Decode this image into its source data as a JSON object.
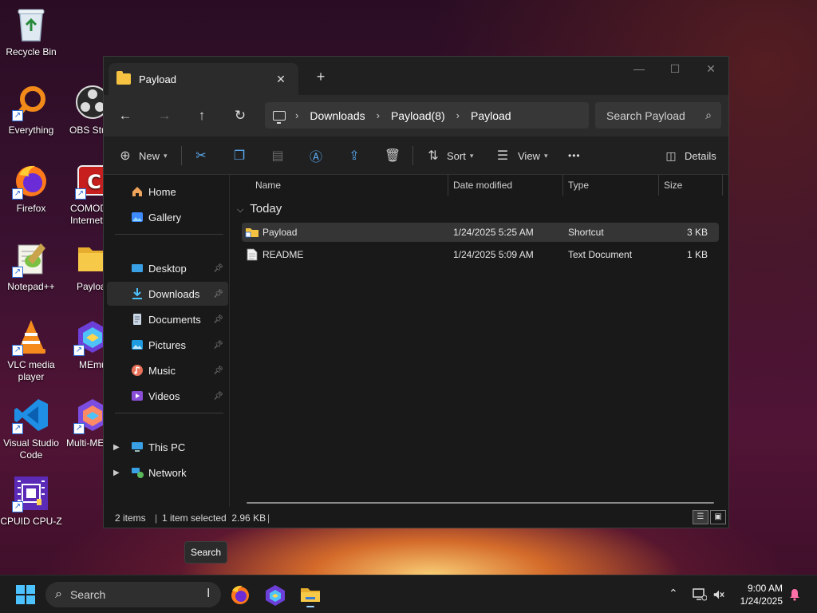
{
  "desktop": {
    "icons": [
      {
        "label": "Recycle Bin"
      },
      {
        "label": "Everything"
      },
      {
        "label": "OBS Stu"
      },
      {
        "label": "Firefox"
      },
      {
        "label": "COMOD Internet"
      },
      {
        "label": "Notepad++"
      },
      {
        "label": "Payloa"
      },
      {
        "label": "VLC media player"
      },
      {
        "label": "MEmu"
      },
      {
        "label": "Visual Studio Code"
      },
      {
        "label": "Multi-ME"
      },
      {
        "label": "CPUID CPU-Z"
      }
    ]
  },
  "explorer": {
    "tab_title": "Payload",
    "breadcrumbs": [
      "Downloads",
      "Payload(8)",
      "Payload"
    ],
    "search_placeholder": "Search Payload",
    "toolbar": {
      "new_label": "New",
      "sort_label": "Sort",
      "view_label": "View",
      "more_label": "•••",
      "details_label": "Details"
    },
    "sidebar": {
      "top": [
        {
          "label": "Home"
        },
        {
          "label": "Gallery"
        }
      ],
      "quick": [
        {
          "label": "Desktop"
        },
        {
          "label": "Downloads"
        },
        {
          "label": "Documents"
        },
        {
          "label": "Pictures"
        },
        {
          "label": "Music"
        },
        {
          "label": "Videos"
        }
      ],
      "bottom": [
        {
          "label": "This PC"
        },
        {
          "label": "Network"
        }
      ]
    },
    "columns": [
      "Name",
      "Date modified",
      "Type",
      "Size"
    ],
    "group_label": "Today",
    "files": [
      {
        "name": "Payload",
        "date": "1/24/2025 5:25 AM",
        "type": "Shortcut",
        "size": "3 KB"
      },
      {
        "name": "README",
        "date": "1/24/2025 5:09 AM",
        "type": "Text Document",
        "size": "1 KB"
      }
    ],
    "status": {
      "items": "2 items",
      "selected": "1 item selected  2.96 KB"
    }
  },
  "tooltip": "Search",
  "taskbar": {
    "search_placeholder": "Search",
    "time": "9:00 AM",
    "date": "1/24/2025"
  },
  "colors": {
    "accent": "#4cc2ff",
    "folder": "#f5c242"
  }
}
